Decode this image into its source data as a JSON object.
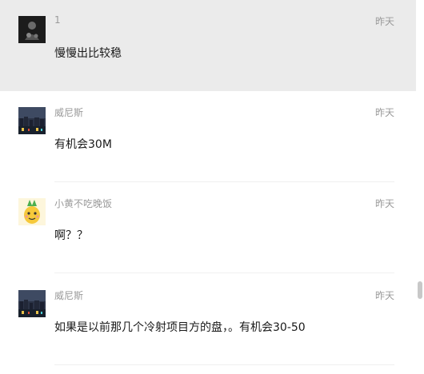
{
  "messages": [
    {
      "name": "1",
      "time": "昨天",
      "text": "慢慢出比较稳",
      "avatar_icon": "dark-figure-avatar-icon"
    },
    {
      "name": "威尼斯",
      "time": "昨天",
      "text": "有机会30M",
      "avatar_icon": "night-city-avatar-icon"
    },
    {
      "name": "小黄不吃晚饭",
      "time": "昨天",
      "text": "啊？？",
      "avatar_icon": "pineapple-avatar-icon"
    },
    {
      "name": "威尼斯",
      "time": "昨天",
      "text": "如果是以前那几个冷射项目方的盘，。有机会30-50",
      "avatar_icon": "night-city-avatar-icon"
    }
  ],
  "colors": {
    "highlight": "#ebebeb",
    "meta_text": "#9a9a9a",
    "body_text": "#1a1a1a"
  }
}
